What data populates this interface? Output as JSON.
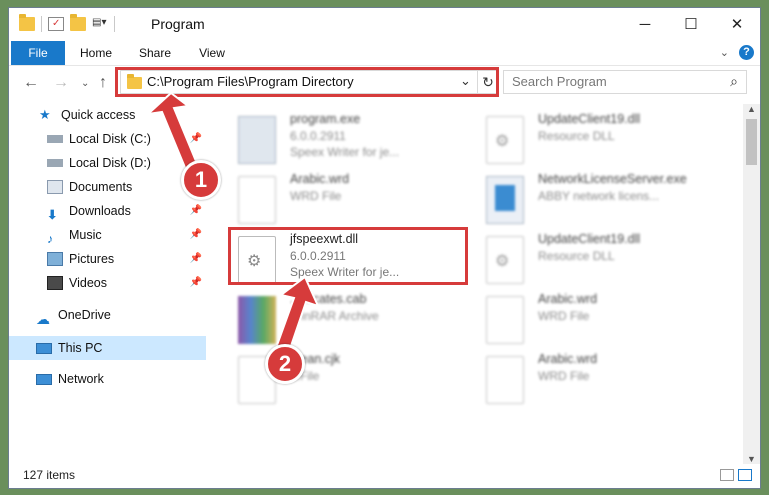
{
  "window": {
    "title": "Program",
    "controls": [
      "─",
      "☐",
      "✕"
    ]
  },
  "ribbon": {
    "tabs": [
      "File",
      "Home",
      "Share",
      "View"
    ],
    "help": "?"
  },
  "address": {
    "path": "C:\\Program Files\\Program Directory"
  },
  "search": {
    "placeholder": "Search Program"
  },
  "sidebar": {
    "quick_access": "Quick access",
    "items": [
      {
        "label": "Local Disk (C:)"
      },
      {
        "label": "Local Disk (D:)"
      },
      {
        "label": "Documents"
      },
      {
        "label": "Downloads"
      },
      {
        "label": "Music"
      },
      {
        "label": "Pictures"
      },
      {
        "label": "Videos"
      }
    ],
    "onedrive": "OneDrive",
    "thispc": "This PC",
    "network": "Network"
  },
  "files": [
    {
      "name": "program.exe",
      "l2": "6.0.0.2911",
      "l3": "Speex Writer for je..."
    },
    {
      "name": "UpdateClient19.dll",
      "l2": "Resource DLL",
      "l3": ""
    },
    {
      "name": "Arabic.wrd",
      "l2": "WRD File",
      "l3": ""
    },
    {
      "name": "NetworkLicenseServer.exe",
      "l2": "ABBY network licens...",
      "l3": ""
    },
    {
      "name": "jfspeexwt.dll",
      "l2": "6.0.0.2911",
      "l3": "Speex Writer for je..."
    },
    {
      "name": "UpdateClient19.dll",
      "l2": "Resource DLL",
      "l3": ""
    },
    {
      "name": "...tificates.cab",
      "l2": "WinRAR Archive",
      "l3": ""
    },
    {
      "name": "Arabic.wrd",
      "l2": "WRD File",
      "l3": ""
    },
    {
      "name": "...ean.cjk",
      "l2": "...File",
      "l3": ""
    },
    {
      "name": "Arabic.wrd",
      "l2": "WRD File",
      "l3": ""
    }
  ],
  "status": {
    "count": "127 items"
  },
  "annotations": {
    "step1": "1",
    "step2": "2"
  },
  "colors": {
    "accent": "#1979ca",
    "highlight": "#d63b3b",
    "selected": "#cce8ff"
  }
}
